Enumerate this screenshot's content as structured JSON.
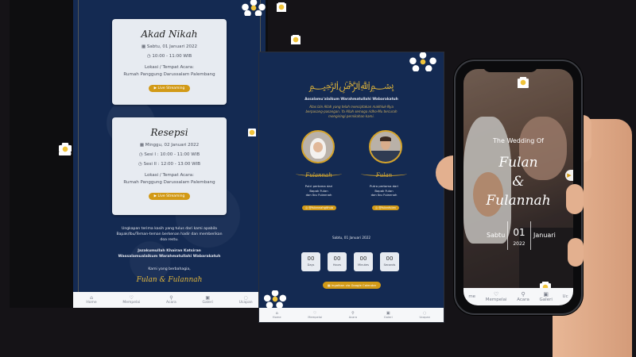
{
  "colors": {
    "navy": "#142a52",
    "gold": "#d29a17",
    "card": "#e7ebf1",
    "page_bg": "#151317"
  },
  "screen1": {
    "akad": {
      "title": "Akad Nikah",
      "date": "Sabtu, 01 Januari 2022",
      "time": "10:00 - 11:00 WIB",
      "location_label": "Lokasi / Tempat Acara:",
      "location": "Rumah Panggung Darussalam Palembang",
      "button": "Live Streaming"
    },
    "resepsi": {
      "title": "Resepsi",
      "date": "Minggu, 02 Januari 2022",
      "sesi1": "Sesi I : 10:00 - 11:00 WIB",
      "sesi2": "Sesi II : 12:00 - 13:00 WIB",
      "location_label": "Lokasi / Tempat Acara:",
      "location": "Rumah Panggung Darussalam Palembang",
      "button": "Live Streaming"
    },
    "thanks_line1": "Ungkapan terima kasih yang tulus dari kami apabila",
    "thanks_line2": "Bapak/Ibu/Teman-teman berkenan hadir dan memberikan",
    "thanks_line3": "doa restu.",
    "jazakumullah1": "Jazakumullah Khairan Katsiran",
    "jazakumullah2": "Wassalamualaikum Warahmatullahi Wabarakatuh",
    "regards": "Kami yang berbahagia,",
    "couple": "Fulan & Fulannah",
    "nav": [
      "Home",
      "Mempelai",
      "Acara",
      "Galeri",
      "Ucapan"
    ]
  },
  "screen2": {
    "greeting": "Assalamu'alaikum Warahmatullahi Wabarakatuh",
    "intro1": "Atas Izin Allah yang telah menciptakan makhluk-Nya",
    "intro2": "berpasang-pasangan. Ya Allah semoga ridho-Mu tercurah",
    "intro3": "mengiringi pernikahan kami.",
    "bride_name": "Fulannah",
    "groom_name": "Fulan",
    "bride_parent1": "Putri pertama dari",
    "bride_parent2": "Bapak Fulan",
    "bride_parent3": "dan Ibu Fulannah",
    "groom_parent1": "Putra pertama dari",
    "groom_parent2": "Bapak Fulan",
    "groom_parent3": "dan Ibu Fulannah",
    "bride_ig": "@fulannahgithub",
    "groom_ig": "@fulanfulan",
    "date": "Sabtu, 01 Januari 2022",
    "countdown": [
      {
        "value": "00",
        "unit": "Days"
      },
      {
        "value": "00",
        "unit": "Hours"
      },
      {
        "value": "00",
        "unit": "Minutes"
      },
      {
        "value": "00",
        "unit": "Seconds"
      }
    ],
    "calendar_button": "Ingatkan via Google Calendar",
    "nav": [
      "Home",
      "Mempelai",
      "Acara",
      "Galeri",
      "Ucapan"
    ]
  },
  "phone": {
    "the_wedding_of": "The Wedding Of",
    "groom": "Fulan",
    "amp": "&",
    "bride": "Fulannah",
    "day": "Sabtu",
    "date_num": "01",
    "month": "Januari",
    "year": "2022",
    "nav": [
      "me",
      "Mempelai",
      "Acara",
      "Galeri",
      "Uc"
    ]
  }
}
